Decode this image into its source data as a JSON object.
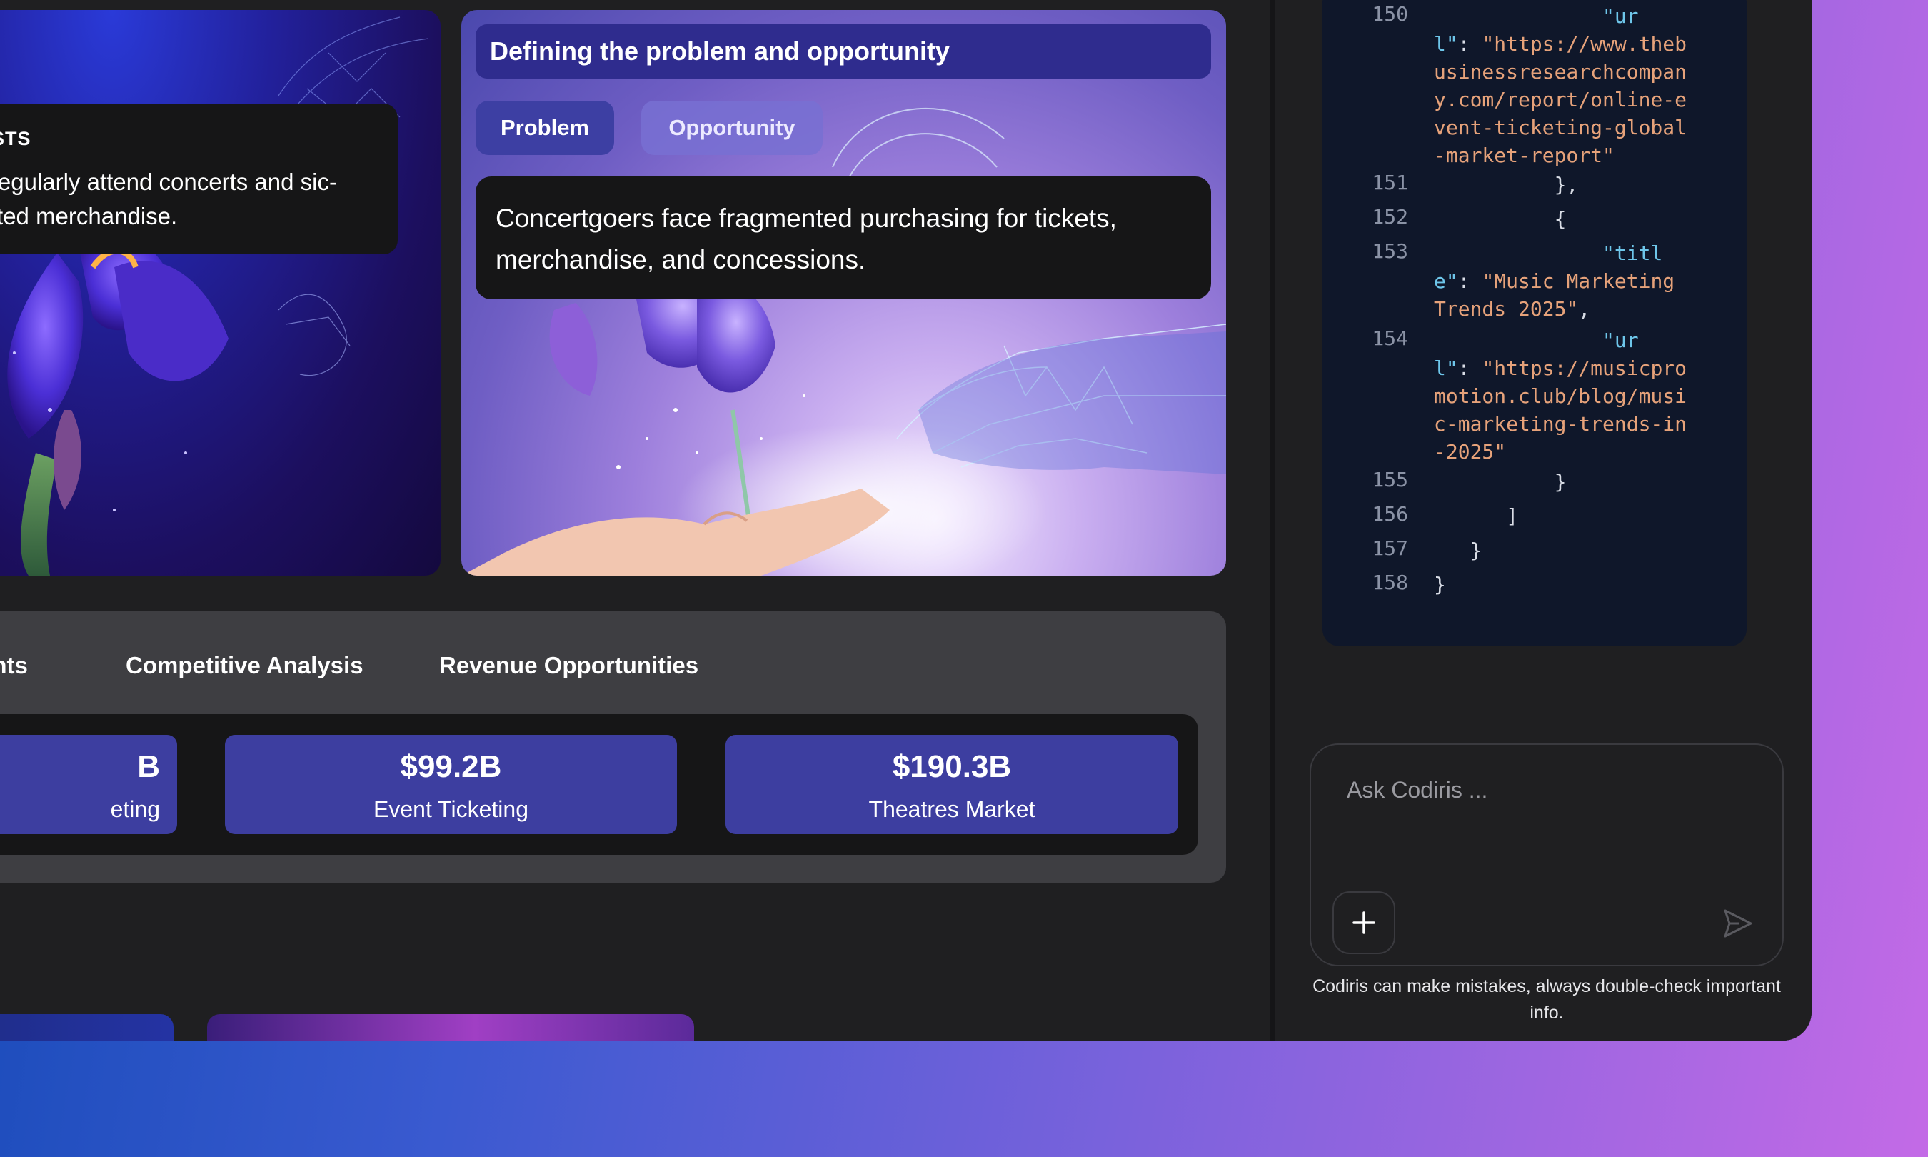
{
  "audience_card": {
    "title": "SIASTS",
    "description": "ho regularly attend concerts and sic-related merchandise."
  },
  "problem_card": {
    "title": "Defining the problem and opportunity",
    "tabs": [
      {
        "label": "Problem",
        "active": true
      },
      {
        "label": "Opportunity",
        "active": false
      }
    ],
    "description": "Concertgoers face fragmented purchasing for tickets, merchandise, and concessions."
  },
  "analysis": {
    "tabs": [
      {
        "label": "oints"
      },
      {
        "label": "Competitive Analysis"
      },
      {
        "label": "Revenue Opportunities"
      }
    ],
    "metrics": [
      {
        "value": "B",
        "label": "eting"
      },
      {
        "value": "$99.2B",
        "label": "Event Ticketing"
      },
      {
        "value": "$190.3B",
        "label": "Theatres Market"
      }
    ]
  },
  "code_panel": {
    "lines": [
      {
        "num": "150",
        "text": "            \"url\": \"https://www.thebusinessresearchcompany.com/report/online-event-ticketing-global-market-report\""
      },
      {
        "num": "151",
        "text": "        },"
      },
      {
        "num": "152",
        "text": "        {"
      },
      {
        "num": "153",
        "text": "            \"title\": \"Music Marketing Trends 2025\","
      },
      {
        "num": "154",
        "text": "            \"url\": \"https://musicpromotion.club/blog/music-marketing-trends-in-2025\""
      },
      {
        "num": "155",
        "text": "        }"
      },
      {
        "num": "156",
        "text": "    ]"
      },
      {
        "num": "157",
        "text": "  }"
      },
      {
        "num": "158",
        "text": "}"
      }
    ]
  },
  "chat": {
    "placeholder": "Ask Codiris ...",
    "attach_icon": "plus-icon",
    "send_icon": "send-icon",
    "disclaimer": "Codiris can make mistakes, always double-check important info."
  },
  "colors": {
    "accent_indigo": "#3d3ea0",
    "code_bg": "#0f172a",
    "code_key": "#6ec6ea",
    "code_string": "#e6a27a"
  }
}
